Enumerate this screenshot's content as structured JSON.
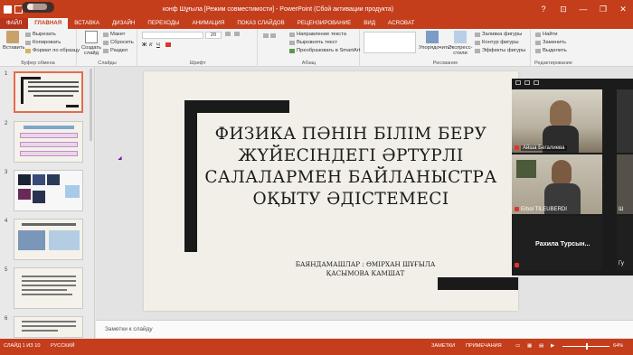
{
  "window": {
    "title": "конф Шұғыла [Режим совместимости] - PowerPoint (Сбой активации продукта)",
    "controls": [
      "?",
      "⊡",
      "—",
      "❐",
      "✕"
    ]
  },
  "tabs": [
    "ФАЙЛ",
    "ГЛАВНАЯ",
    "ВСТАВКА",
    "ДИЗАЙН",
    "ПЕРЕХОДЫ",
    "АНИМАЦИЯ",
    "ПОКАЗ СЛАЙДОВ",
    "РЕЦЕНЗИРОВАНИЕ",
    "ВИД",
    "ACROBAT"
  ],
  "ribbon": {
    "clipboard": {
      "paste": "Вставить",
      "cut": "Вырезать",
      "copy": "Копировать",
      "format": "Формат по образцу",
      "label": "Буфер обмена"
    },
    "slides": {
      "new_slide": "Создать слайд",
      "layout": "Макет",
      "reset": "Сбросить",
      "section": "Раздел",
      "label": "Слайды"
    },
    "font": {
      "size": "20",
      "label": "Шрифт"
    },
    "paragraph": {
      "text_direction": "Направление текста",
      "align_text": "Выровнять текст",
      "smartart": "Преобразовать в SmartArt",
      "label": "Абзац"
    },
    "drawing": {
      "arrange": "Упорядочить",
      "styles": "Экспресс-стили",
      "fill": "Заливка фигуры",
      "outline": "Контур фигуры",
      "effects": "Эффекты фигуры",
      "label": "Рисование"
    },
    "editing": {
      "find": "Найти",
      "replace": "Заменить",
      "select": "Выделить",
      "label": "Редактирование"
    }
  },
  "thumbnails": [
    "1",
    "2",
    "3",
    "4",
    "5",
    "6"
  ],
  "slide": {
    "title": "ФИЗИКА ПӘНІН БІЛІМ БЕРУ ЖҮЙЕСІНДЕГІ ӘРТҮРЛІ САЛАЛАРМЕН БАЙЛАНЫСТРА ОҚЫТУ ӘДІСТЕМЕСІ",
    "author_line1": "БАЯНДАМАШЛАР : ӨМІРХАН ШҰҒЫЛА",
    "author_line2": "ҚАСЫМОВА КАМШАТ"
  },
  "notes_placeholder": "Заметки к слайду",
  "status": {
    "slide_info": "СЛАЙД 1 ИЗ 10",
    "language": "РУССКИЙ",
    "notes": "ЗАМЕТКИ",
    "comments": "ПРИМЕЧАНИЯ",
    "zoom": "64%"
  },
  "video_call": {
    "participants": [
      "Айша Бегалиева",
      "Erbol TILEUBERDI",
      "Рахила Турсын..."
    ],
    "side_labels": [
      "Ш",
      "Гу"
    ]
  }
}
